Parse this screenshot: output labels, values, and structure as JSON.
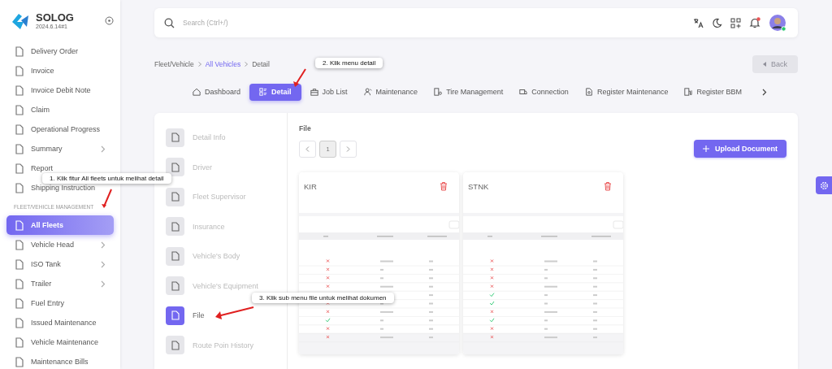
{
  "sidebar": {
    "brand": "SOLOG",
    "version": "2024.6.14#1",
    "items": [
      {
        "label": "Delivery Order",
        "expandable": false,
        "selected": false
      },
      {
        "label": "Invoice",
        "expandable": false,
        "selected": false
      },
      {
        "label": "Invoice Debit Note",
        "expandable": false,
        "selected": false
      },
      {
        "label": "Claim",
        "expandable": false,
        "selected": false
      },
      {
        "label": "Operational Progress",
        "expandable": false,
        "selected": false
      },
      {
        "label": "Summary",
        "expandable": true,
        "selected": false
      },
      {
        "label": "Report",
        "expandable": false,
        "selected": false
      },
      {
        "label": "Shipping Instruction",
        "expandable": false,
        "selected": false
      },
      {
        "kind": "section",
        "label": "FLEET/VEHICLE MANAGEMENT"
      },
      {
        "label": "All Fleets",
        "expandable": false,
        "selected": true
      },
      {
        "label": "Vehicle Head",
        "expandable": true,
        "selected": false
      },
      {
        "label": "ISO Tank",
        "expandable": true,
        "selected": false
      },
      {
        "label": "Trailer",
        "expandable": true,
        "selected": false
      },
      {
        "label": "Fuel Entry",
        "expandable": false,
        "selected": false
      },
      {
        "label": "Issued Maintenance",
        "expandable": false,
        "selected": false
      },
      {
        "label": "Vehicle Maintenance",
        "expandable": false,
        "selected": false
      },
      {
        "label": "Maintenance Bills",
        "expandable": false,
        "selected": false
      }
    ]
  },
  "search": {
    "placeholder": "Search (Ctrl+/)"
  },
  "notifications": {
    "unread": true
  },
  "breadcrumb": [
    {
      "label": "Fleet/Vehicle",
      "link": false
    },
    {
      "label": "All Vehicles",
      "link": true
    },
    {
      "label": "Detail",
      "link": false
    }
  ],
  "back_button": {
    "label": "Back",
    "disabled": true
  },
  "tabs": [
    {
      "label": "Dashboard",
      "selected": false
    },
    {
      "label": "Detail",
      "selected": true
    },
    {
      "label": "Job List",
      "selected": false
    },
    {
      "label": "Maintenance",
      "selected": false
    },
    {
      "label": "Tire Management",
      "selected": false
    },
    {
      "label": "Connection",
      "selected": false
    },
    {
      "label": "Register Maintenance",
      "selected": false
    },
    {
      "label": "Register BBM",
      "selected": false
    }
  ],
  "submenu": [
    {
      "label": "Detail Info",
      "selected": false
    },
    {
      "label": "Driver",
      "selected": false
    },
    {
      "label": "Fleet Supervisor",
      "selected": false
    },
    {
      "label": "Insurance",
      "selected": false
    },
    {
      "label": "Vehicle's Body",
      "selected": false
    },
    {
      "label": "Vehicle's Equipment",
      "selected": false
    },
    {
      "label": "File",
      "selected": true
    },
    {
      "label": "Route Poin History",
      "selected": false
    }
  ],
  "file_section": {
    "title": "File",
    "pages": [
      {
        "label": "1",
        "selected": true
      }
    ],
    "upload_button": "Upload Document",
    "files": [
      {
        "name": "KIR"
      },
      {
        "name": "STNK"
      }
    ]
  },
  "callouts": [
    {
      "text": "1. Klik fitur All fleets untuk melihat detail"
    },
    {
      "text": "2. Klik menu detail"
    },
    {
      "text": "3. Klik sub menu file untuk melihat dokumen"
    }
  ]
}
